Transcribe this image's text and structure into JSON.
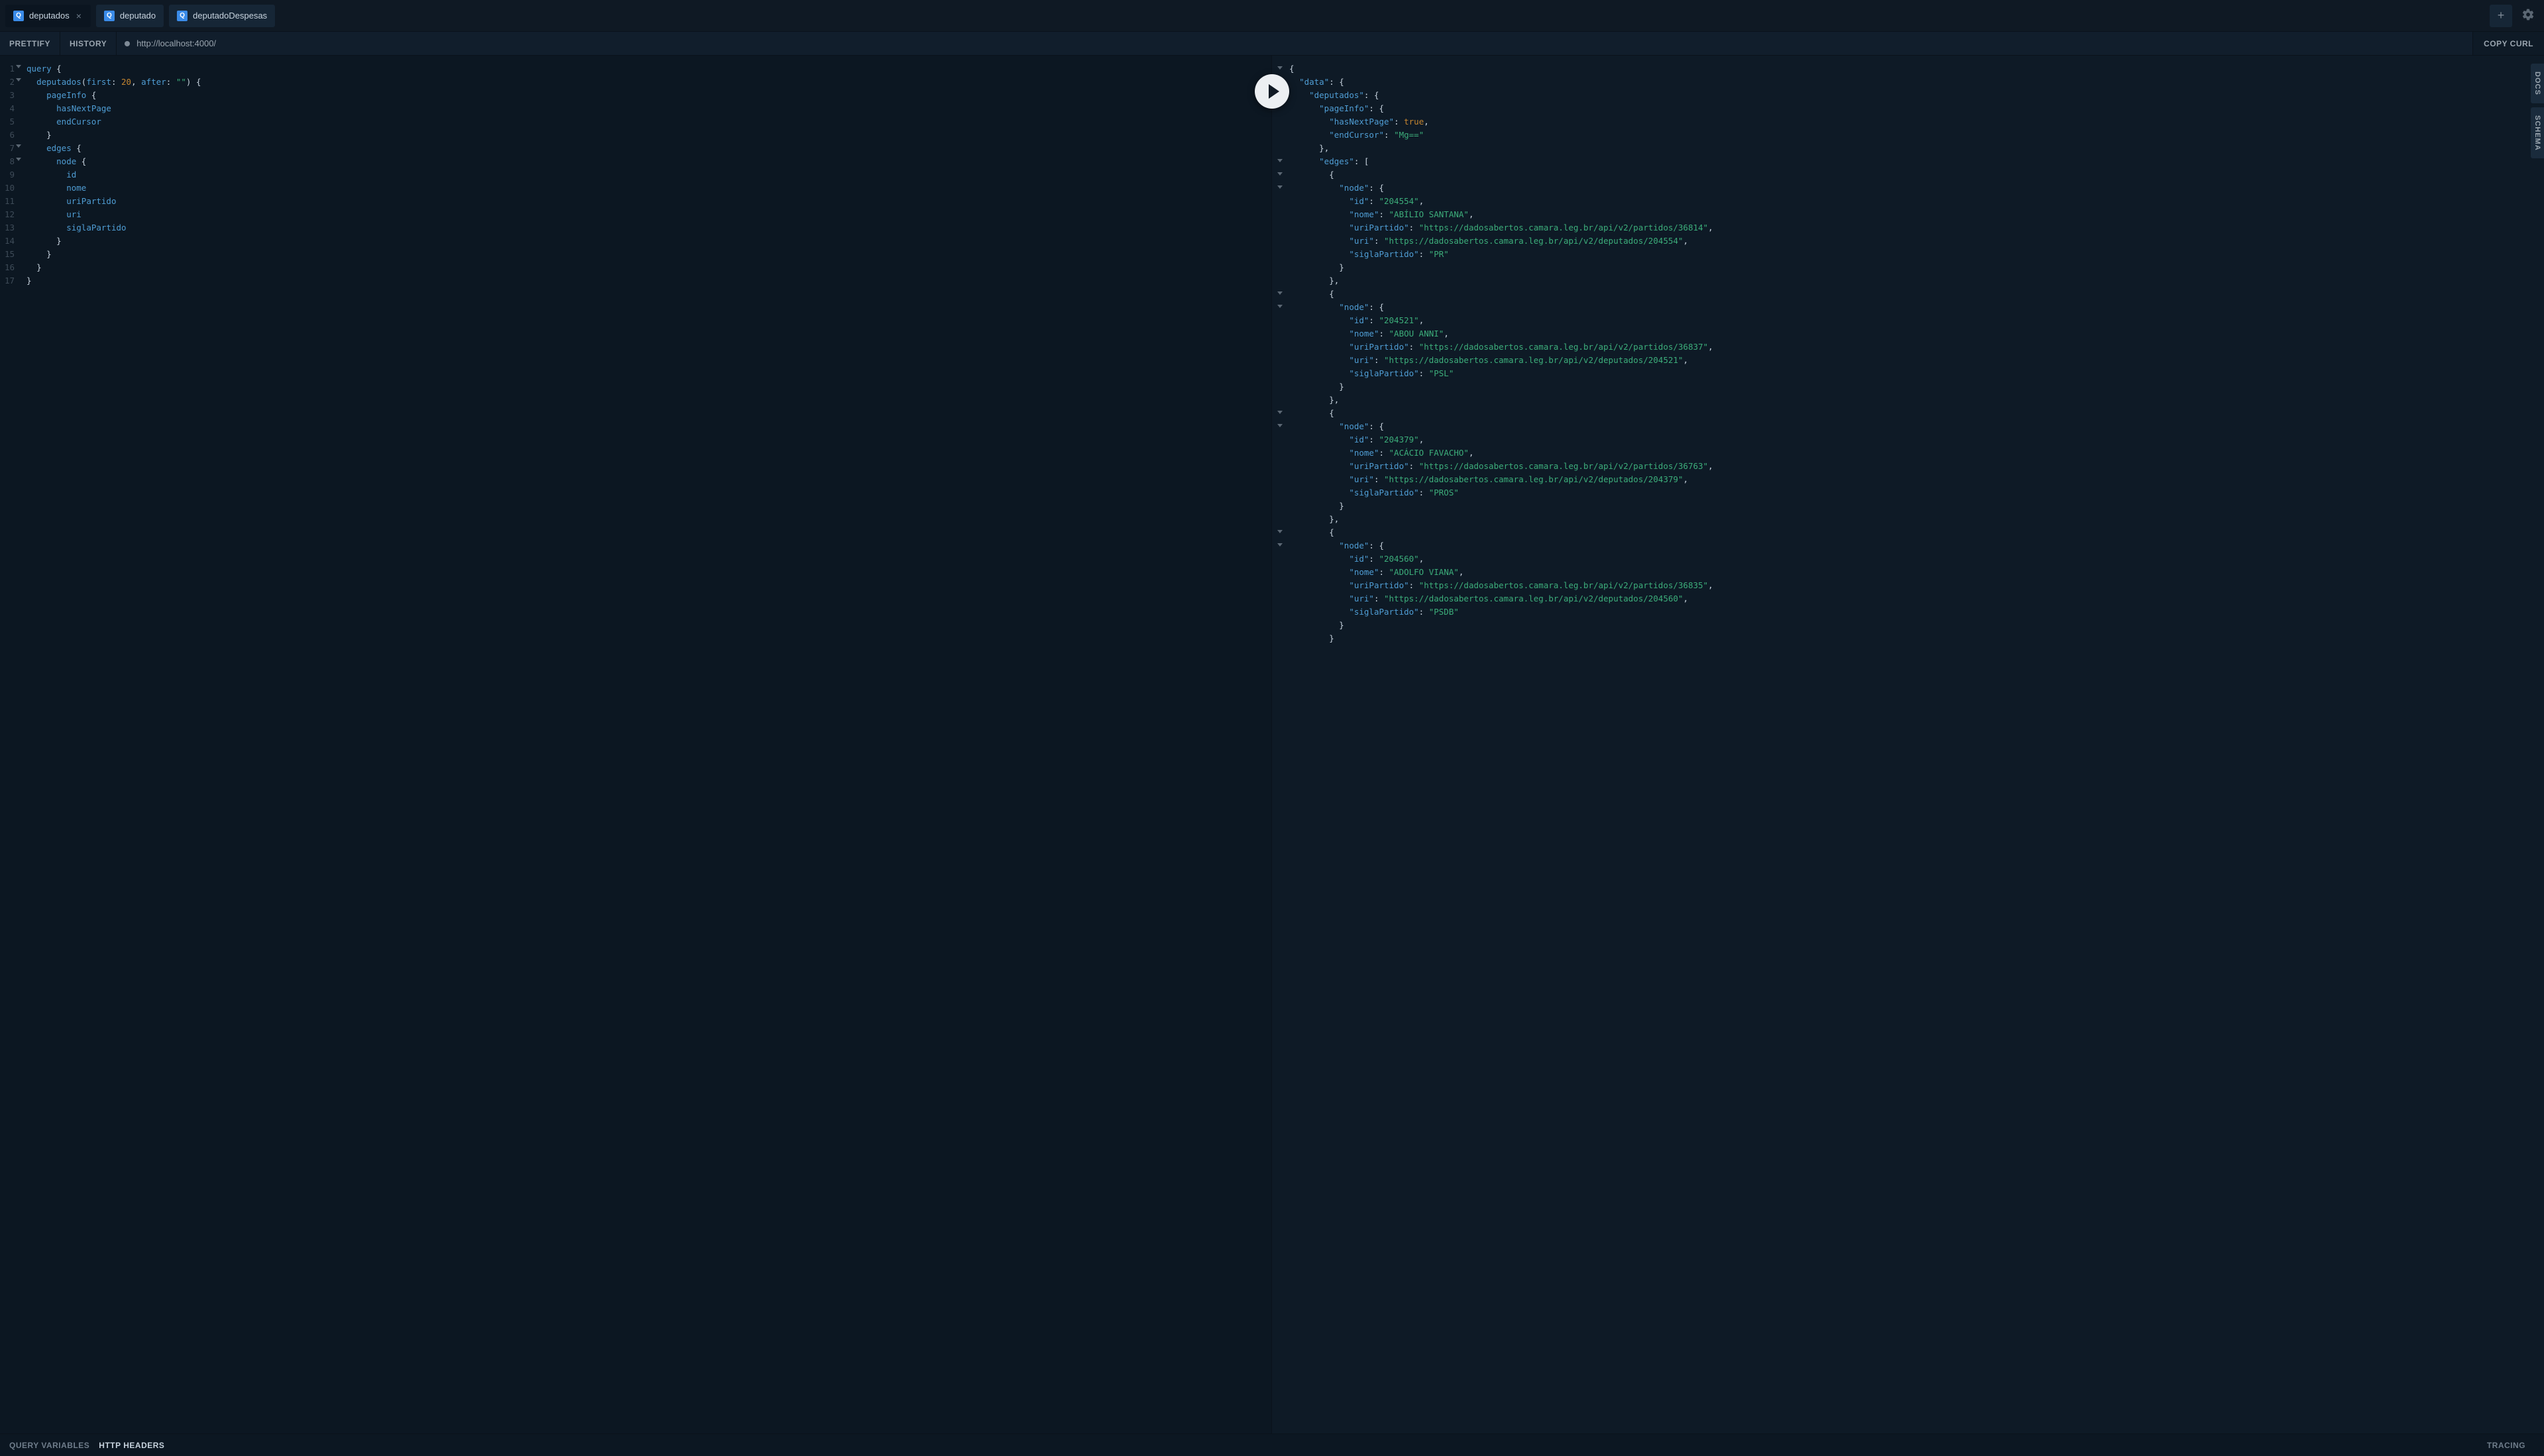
{
  "tabs": [
    {
      "label": "deputados",
      "active": true
    },
    {
      "label": "deputado",
      "active": false
    },
    {
      "label": "deputadoDespesas",
      "active": false
    }
  ],
  "toolbar": {
    "prettify": "PRETTIFY",
    "history": "HISTORY",
    "endpoint": "http://localhost:4000/",
    "copyCurl": "COPY CURL"
  },
  "rail": {
    "docs": "DOCS",
    "schema": "SCHEMA"
  },
  "footer": {
    "queryVariables": "QUERY VARIABLES",
    "httpHeaders": "HTTP HEADERS",
    "tracing": "TRACING"
  },
  "editor": {
    "lineCount": 17,
    "foldLines": [
      1,
      2,
      7,
      8
    ],
    "query": {
      "first": 20,
      "after": "",
      "pageInfoFields": [
        "hasNextPage",
        "endCursor"
      ],
      "nodeFields": [
        "id",
        "nome",
        "uriPartido",
        "uri",
        "siglaPartido"
      ]
    }
  },
  "result": {
    "data": {
      "deputados": {
        "pageInfo": {
          "hasNextPage": true,
          "endCursor": "Mg=="
        },
        "edges": [
          {
            "node": {
              "id": "204554",
              "nome": "ABÍLIO SANTANA",
              "uriPartido": "https://dadosabertos.camara.leg.br/api/v2/partidos/36814",
              "uri": "https://dadosabertos.camara.leg.br/api/v2/deputados/204554",
              "siglaPartido": "PR"
            }
          },
          {
            "node": {
              "id": "204521",
              "nome": "ABOU ANNI",
              "uriPartido": "https://dadosabertos.camara.leg.br/api/v2/partidos/36837",
              "uri": "https://dadosabertos.camara.leg.br/api/v2/deputados/204521",
              "siglaPartido": "PSL"
            }
          },
          {
            "node": {
              "id": "204379",
              "nome": "ACÁCIO FAVACHO",
              "uriPartido": "https://dadosabertos.camara.leg.br/api/v2/partidos/36763",
              "uri": "https://dadosabertos.camara.leg.br/api/v2/deputados/204379",
              "siglaPartido": "PROS"
            }
          },
          {
            "node": {
              "id": "204560",
              "nome": "ADOLFO VIANA",
              "uriPartido": "https://dadosabertos.camara.leg.br/api/v2/partidos/36835",
              "uri": "https://dadosabertos.camara.leg.br/api/v2/deputados/204560",
              "siglaPartido": "PSDB"
            }
          }
        ]
      }
    }
  }
}
